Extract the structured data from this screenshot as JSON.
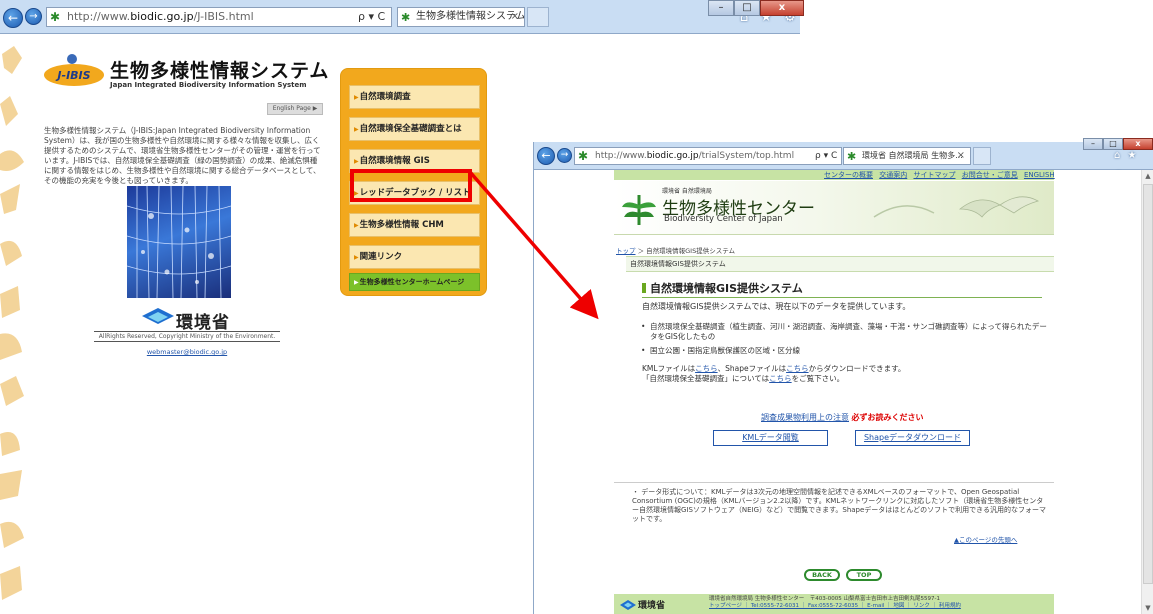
{
  "left_browser": {
    "url_prefix": "http://www.",
    "url_host": "biodic.go.jp",
    "url_path": "/J-IBIS.html",
    "addr_controls": "ρ ▾ C",
    "tab_title": "生物多様性情報システム",
    "tab_close": "×",
    "toolbar_icons": "⌂ ★ ⚙",
    "back_glyph": "←",
    "forward_glyph": "→",
    "window_min": "–",
    "window_max": "□",
    "window_close": "x"
  },
  "jibis": {
    "logo_text": "J-IBIS",
    "title": "生物多様性情報システム",
    "subtitle": "Japan Integrated Biodiversity Information System",
    "english_page": "English Page ▶",
    "intro": "生物多様性情報システム（J-IBIS:Japan Integrated Biodiversity Information System）は、我が国の生物多様性や自然環境に関する様々な情報を収集し、広く提供するためのシステムで、環境省生物多様性センターがその管理・運営を行っています。J-IBISでは、自然環境保全基礎調査（緑の国勢調査）の成果、絶滅危惧種に関する情報をはじめ、生物多様性や自然環境に関する総合データベースとして、その機能の充実を今後とも図っていきます。",
    "ministry": "環境省",
    "copyright": "AllRights Reserved, Copyright Ministry of the Environment.",
    "webmaster": "webmaster@biodic.go.jp",
    "menu": [
      "自然環境調査",
      "自然環境保全基礎調査とは",
      "自然環境情報 GIS",
      "レッドデータブック / リスト",
      "生物多様性情報 CHM",
      "関連リンク"
    ],
    "menu_home": "生物多様性センターホームページ"
  },
  "right_browser": {
    "url_prefix": "http://www.",
    "url_host": "biodic.go.jp",
    "url_path": "/trialSystem/top.html",
    "addr_controls": "ρ ▾ C",
    "tab_title": "環境省 自然環境局 生物多...",
    "tab_close": "×",
    "toolbar_icons": "⌂ ★ ⚙"
  },
  "center": {
    "top_links": [
      "センターの概要",
      "交通案内",
      "サイトマップ",
      "お問合せ・ご意見",
      "ENGLISH"
    ],
    "org": "環境省 自然環境局",
    "name": "生物多様性センター",
    "name_en": "Biodiversity Center of Japan",
    "crumb_home": "トップ",
    "crumb_sep": " ＞ ",
    "crumb_current": "自然環境情報GIS提供システム",
    "subbar": "自然環境情報GIS提供システム",
    "heading": "自然環境情報GIS提供システム",
    "lead": "自然環境情報GIS提供システムでは、現在以下のデータを提供しています。",
    "bullets": [
      "自然環境保全基礎調査（植生調査、河川・湖沼調査、海岸調査、藻場・干潟・サンゴ礁調査等）によって得られたデータをGIS化したもの",
      "国立公園・国指定鳥獣保護区の区域・区分線"
    ],
    "kml_a": "KMLファイルは",
    "kml_link1": "こちら",
    "kml_b": "、Shapeファイルは",
    "kml_link2": "こちら",
    "kml_c": "からダウンロードできます。",
    "survey_a": "「自然環境保全基礎調査」については",
    "survey_link": "こちら",
    "survey_b": "をご覧下さい。",
    "notice_link": "調査成果物利用上の注意",
    "notice_red": "必ずお読みください",
    "btn_kml": "KMLデータ閲覧",
    "btn_shape": "Shapeデータダウンロード",
    "note": "・ データ形式について：KMLデータは3次元の地理空間情報を記述できるXMLベースのフォーマットで、Open Geospatial Consortium (OGC)の規格（KMLバージョン2.2以降）です。KMLネットワークリンクに対応したソフト（環境省生物多様性センター自然環境情報GISソフトウェア（NEIG）など）で閲覧できます。Shapeデータはほとんどのソフトで利用できる汎用的なフォーマットです。",
    "to_top": "▲このページの先頭へ",
    "back": "BACK",
    "top": "TOP",
    "footer_line1": "環境省自然環境局 生物多様性センター　〒403-0005 山梨県富士吉田市上吉田剣丸尾5597-1",
    "footer_line2": "トップページ ｜ Tel:0555-72-6031 ｜ Fax:0555-72-6035 ｜ E-mail ｜ 地図 ｜ リンク ｜ 利用規約",
    "footer_ministry": "環境省"
  },
  "colors": {
    "menu_bg": "#f2a81d",
    "menu_item": "#fbe7b1",
    "highlight": "#ee0000",
    "arrow": "#ee0000",
    "center_green": "#c7e3a4",
    "link": "#2255aa"
  }
}
